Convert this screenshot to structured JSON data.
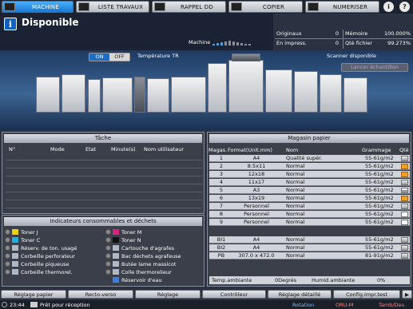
{
  "tabs": [
    {
      "label": "MACHINE",
      "active": true
    },
    {
      "label": "LISTE TRAVAUX",
      "active": false
    },
    {
      "label": "RAPPEL DD",
      "active": false
    },
    {
      "label": "COPIER",
      "active": false
    },
    {
      "label": "NUMERISER",
      "active": false
    }
  ],
  "header": {
    "status": "Disponible",
    "machine_label": "Machine"
  },
  "counters": {
    "originaux_label": "Originaux",
    "originaux_value": "0",
    "memoire_label": "Mémoire",
    "memoire_value": "100.000%",
    "impress_label": "En impress.",
    "impress_value": "0",
    "qte_fichier_label": "Qté fichier",
    "qte_fichier_value": "99.273%"
  },
  "machine": {
    "toggle_on": "ON",
    "toggle_off": "OFF",
    "temp_label": "Température TR",
    "scanner_label": "Scanner disponible",
    "lancer_button": "Lancer échantillon"
  },
  "tasks": {
    "title": "Tâche",
    "columns": [
      "N°",
      "Mode",
      "Etat",
      "Minute(s)",
      "Nom utilisateur"
    ]
  },
  "consumables": {
    "title": "Indicateurs consommables et déchets",
    "left": [
      "Toner J",
      "Toner C",
      "Réserv. de ton. usagé",
      "Corbeille perforateur",
      "Corbeille piqueuse",
      "Corbeille thermorel."
    ],
    "right": [
      "Toner M",
      "Toner N",
      "Cartouche d'agrafes",
      "Bac déchets agrafeuse",
      "Butée lame massicot",
      "Colle thermorelieur",
      "Réservoir d'eau"
    ]
  },
  "paper": {
    "title": "Magasin papier",
    "columns": [
      "Magas.",
      "Format(Unit.mm)",
      "Nom",
      "Grammage",
      "Qté"
    ],
    "rows": [
      {
        "tray": "1",
        "format": "A4",
        "name": "Qualité supér.",
        "weight": "55-61g/m2",
        "level": "full"
      },
      {
        "tray": "2",
        "format": "8.5x11",
        "name": "Normal",
        "weight": "55-61g/m2",
        "level": "warn"
      },
      {
        "tray": "3",
        "format": "12x18",
        "name": "Normal",
        "weight": "55-61g/m2",
        "level": "warn"
      },
      {
        "tray": "4",
        "format": "11x17",
        "name": "Normal",
        "weight": "55-61g/m2",
        "level": "full"
      },
      {
        "tray": "5",
        "format": "A3",
        "name": "Normal",
        "weight": "55-61g/m2",
        "level": "mid"
      },
      {
        "tray": "6",
        "format": "13x19",
        "name": "Normal",
        "weight": "55-61g/m2",
        "level": "warn"
      },
      {
        "tray": "7",
        "format": "Personnel",
        "name": "Normal",
        "weight": "55-61g/m2",
        "level": "full"
      },
      {
        "tray": "8",
        "format": "Personnel",
        "name": "Normal",
        "weight": "55-61g/m2",
        "level": "low"
      },
      {
        "tray": "9",
        "format": "Personnel",
        "name": "Normal",
        "weight": "55-61g/m2",
        "level": "low"
      }
    ],
    "rows_bottom": [
      {
        "tray": "BI1",
        "format": "A4",
        "name": "Normal",
        "weight": "55-61g/m2",
        "level": "full"
      },
      {
        "tray": "BI2",
        "format": "A4",
        "name": "Normal",
        "weight": "55-61g/m2",
        "level": "full"
      },
      {
        "tray": "PB",
        "format": "307.0 x 472.0",
        "name": "Normal",
        "weight": "81-91g/m2",
        "level": "full"
      }
    ],
    "temp_label": "Temp.ambiante",
    "temp_value": "0Degrés",
    "humid_label": "Humid.ambiante",
    "humid_value": "0%"
  },
  "bottom_buttons": [
    "Réglage papier",
    "Recto-verso",
    "Réglage",
    "Contrôleur",
    "Réglage détaillé",
    "Config.impr.test"
  ],
  "footer": {
    "time": "23:44",
    "message": "Prêt pour réception",
    "rotation": "Rotation",
    "oru": "ORU-M",
    "tamb": "Tamb/Dev."
  }
}
